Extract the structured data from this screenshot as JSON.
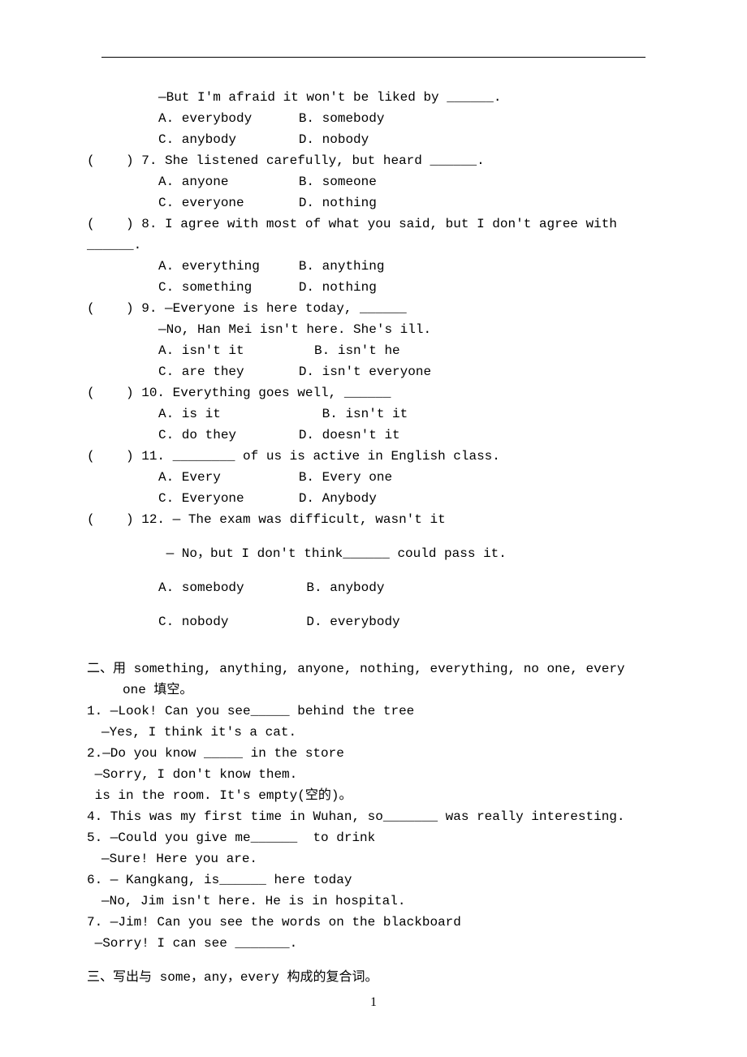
{
  "lines": {
    "l1": "—But I'm afraid it won't be liked by ______.",
    "l2": "A. everybody      B. somebody",
    "l3": "C. anybody        D. nobody",
    "q7": "(    ) 7. She listened carefully, but heard ______.",
    "q7a": "A. anyone         B. someone",
    "q7b": "C. everyone       D. nothing",
    "q8": "(    ) 8. I agree with most of what you said, but I don't agree with",
    "q8end": "______.",
    "q8a": "A. everything     B. anything",
    "q8b": "C. something      D. nothing",
    "q9": "(    ) 9. —Everyone is here today, ______",
    "q9line": "—No, Han Mei isn't here. She's ill.",
    "q9a": "A. isn't it         B. isn't he",
    "q9b": "C. are they       D. isn't everyone",
    "q10": "(    ) 10. Everything goes well, ______",
    "q10a": "A. is it             B. isn't it",
    "q10b": "C. do they        D. doesn't it",
    "q11": "(    ) 11. ________ of us is active in English class.",
    "q11a": "A. Every          B. Every one",
    "q11b": "C. Everyone       D. Anybody",
    "q12": "(    ) 12. — The exam was difficult, wasn't it",
    "q12line": " — No，but I don't think______ could pass it.",
    "q12a": "A. somebody        B. anybody",
    "q12b": "C. nobody          D. everybody"
  },
  "section2": {
    "title_pre": "二、用",
    "title_mid": " something, anything, anyone, nothing, everything, no one, every",
    "title_line2": "one ",
    "title_suf": "填空。",
    "f1": "1. —Look! Can you see_____ behind the tree",
    "f1b": "—Yes, I think it's a cat.",
    "f2": "2.—Do you know _____ in the store",
    "f2b": " —Sorry, I don't know them.",
    "f3": " is in the room. It's empty(空的)。",
    "f4": "4. This was my first time in Wuhan, so_______ was really interesting.",
    "f5": "5. —Could you give me______  to drink",
    "f5b": "—Sure! Here you are.",
    "f6": "6. — Kangkang, is______ here today",
    "f6b": "—No, Jim isn't here. He is in hospital.",
    "f7": "7. —Jim! Can you see the words on the blackboard",
    "f7b": " —Sorry! I can see _______."
  },
  "section3": {
    "title_pre": "三、写出与",
    "title_mid": " some，any，every ",
    "title_suf": "构成的复合词。"
  },
  "footer": "1"
}
